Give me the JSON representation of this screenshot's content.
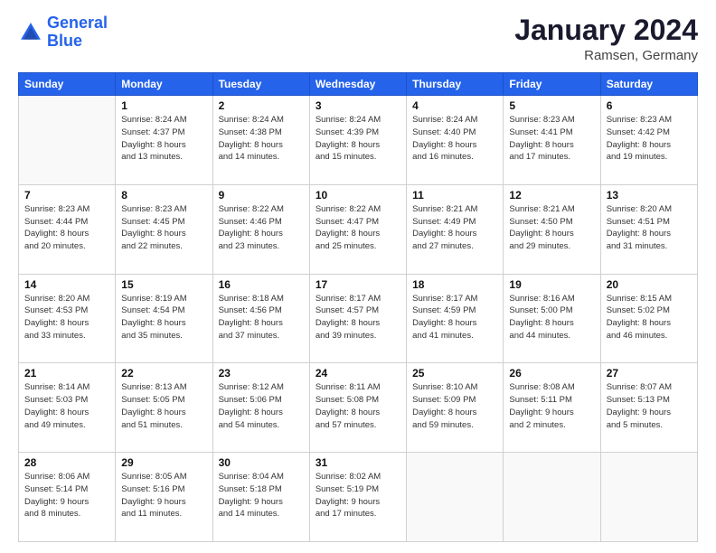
{
  "header": {
    "logo_line1": "General",
    "logo_line2": "Blue",
    "title": "January 2024",
    "subtitle": "Ramsen, Germany"
  },
  "days_of_week": [
    "Sunday",
    "Monday",
    "Tuesday",
    "Wednesday",
    "Thursday",
    "Friday",
    "Saturday"
  ],
  "weeks": [
    [
      {
        "day": "",
        "info": ""
      },
      {
        "day": "1",
        "info": "Sunrise: 8:24 AM\nSunset: 4:37 PM\nDaylight: 8 hours\nand 13 minutes."
      },
      {
        "day": "2",
        "info": "Sunrise: 8:24 AM\nSunset: 4:38 PM\nDaylight: 8 hours\nand 14 minutes."
      },
      {
        "day": "3",
        "info": "Sunrise: 8:24 AM\nSunset: 4:39 PM\nDaylight: 8 hours\nand 15 minutes."
      },
      {
        "day": "4",
        "info": "Sunrise: 8:24 AM\nSunset: 4:40 PM\nDaylight: 8 hours\nand 16 minutes."
      },
      {
        "day": "5",
        "info": "Sunrise: 8:23 AM\nSunset: 4:41 PM\nDaylight: 8 hours\nand 17 minutes."
      },
      {
        "day": "6",
        "info": "Sunrise: 8:23 AM\nSunset: 4:42 PM\nDaylight: 8 hours\nand 19 minutes."
      }
    ],
    [
      {
        "day": "7",
        "info": "Sunrise: 8:23 AM\nSunset: 4:44 PM\nDaylight: 8 hours\nand 20 minutes."
      },
      {
        "day": "8",
        "info": "Sunrise: 8:23 AM\nSunset: 4:45 PM\nDaylight: 8 hours\nand 22 minutes."
      },
      {
        "day": "9",
        "info": "Sunrise: 8:22 AM\nSunset: 4:46 PM\nDaylight: 8 hours\nand 23 minutes."
      },
      {
        "day": "10",
        "info": "Sunrise: 8:22 AM\nSunset: 4:47 PM\nDaylight: 8 hours\nand 25 minutes."
      },
      {
        "day": "11",
        "info": "Sunrise: 8:21 AM\nSunset: 4:49 PM\nDaylight: 8 hours\nand 27 minutes."
      },
      {
        "day": "12",
        "info": "Sunrise: 8:21 AM\nSunset: 4:50 PM\nDaylight: 8 hours\nand 29 minutes."
      },
      {
        "day": "13",
        "info": "Sunrise: 8:20 AM\nSunset: 4:51 PM\nDaylight: 8 hours\nand 31 minutes."
      }
    ],
    [
      {
        "day": "14",
        "info": "Sunrise: 8:20 AM\nSunset: 4:53 PM\nDaylight: 8 hours\nand 33 minutes."
      },
      {
        "day": "15",
        "info": "Sunrise: 8:19 AM\nSunset: 4:54 PM\nDaylight: 8 hours\nand 35 minutes."
      },
      {
        "day": "16",
        "info": "Sunrise: 8:18 AM\nSunset: 4:56 PM\nDaylight: 8 hours\nand 37 minutes."
      },
      {
        "day": "17",
        "info": "Sunrise: 8:17 AM\nSunset: 4:57 PM\nDaylight: 8 hours\nand 39 minutes."
      },
      {
        "day": "18",
        "info": "Sunrise: 8:17 AM\nSunset: 4:59 PM\nDaylight: 8 hours\nand 41 minutes."
      },
      {
        "day": "19",
        "info": "Sunrise: 8:16 AM\nSunset: 5:00 PM\nDaylight: 8 hours\nand 44 minutes."
      },
      {
        "day": "20",
        "info": "Sunrise: 8:15 AM\nSunset: 5:02 PM\nDaylight: 8 hours\nand 46 minutes."
      }
    ],
    [
      {
        "day": "21",
        "info": "Sunrise: 8:14 AM\nSunset: 5:03 PM\nDaylight: 8 hours\nand 49 minutes."
      },
      {
        "day": "22",
        "info": "Sunrise: 8:13 AM\nSunset: 5:05 PM\nDaylight: 8 hours\nand 51 minutes."
      },
      {
        "day": "23",
        "info": "Sunrise: 8:12 AM\nSunset: 5:06 PM\nDaylight: 8 hours\nand 54 minutes."
      },
      {
        "day": "24",
        "info": "Sunrise: 8:11 AM\nSunset: 5:08 PM\nDaylight: 8 hours\nand 57 minutes."
      },
      {
        "day": "25",
        "info": "Sunrise: 8:10 AM\nSunset: 5:09 PM\nDaylight: 8 hours\nand 59 minutes."
      },
      {
        "day": "26",
        "info": "Sunrise: 8:08 AM\nSunset: 5:11 PM\nDaylight: 9 hours\nand 2 minutes."
      },
      {
        "day": "27",
        "info": "Sunrise: 8:07 AM\nSunset: 5:13 PM\nDaylight: 9 hours\nand 5 minutes."
      }
    ],
    [
      {
        "day": "28",
        "info": "Sunrise: 8:06 AM\nSunset: 5:14 PM\nDaylight: 9 hours\nand 8 minutes."
      },
      {
        "day": "29",
        "info": "Sunrise: 8:05 AM\nSunset: 5:16 PM\nDaylight: 9 hours\nand 11 minutes."
      },
      {
        "day": "30",
        "info": "Sunrise: 8:04 AM\nSunset: 5:18 PM\nDaylight: 9 hours\nand 14 minutes."
      },
      {
        "day": "31",
        "info": "Sunrise: 8:02 AM\nSunset: 5:19 PM\nDaylight: 9 hours\nand 17 minutes."
      },
      {
        "day": "",
        "info": ""
      },
      {
        "day": "",
        "info": ""
      },
      {
        "day": "",
        "info": ""
      }
    ]
  ]
}
